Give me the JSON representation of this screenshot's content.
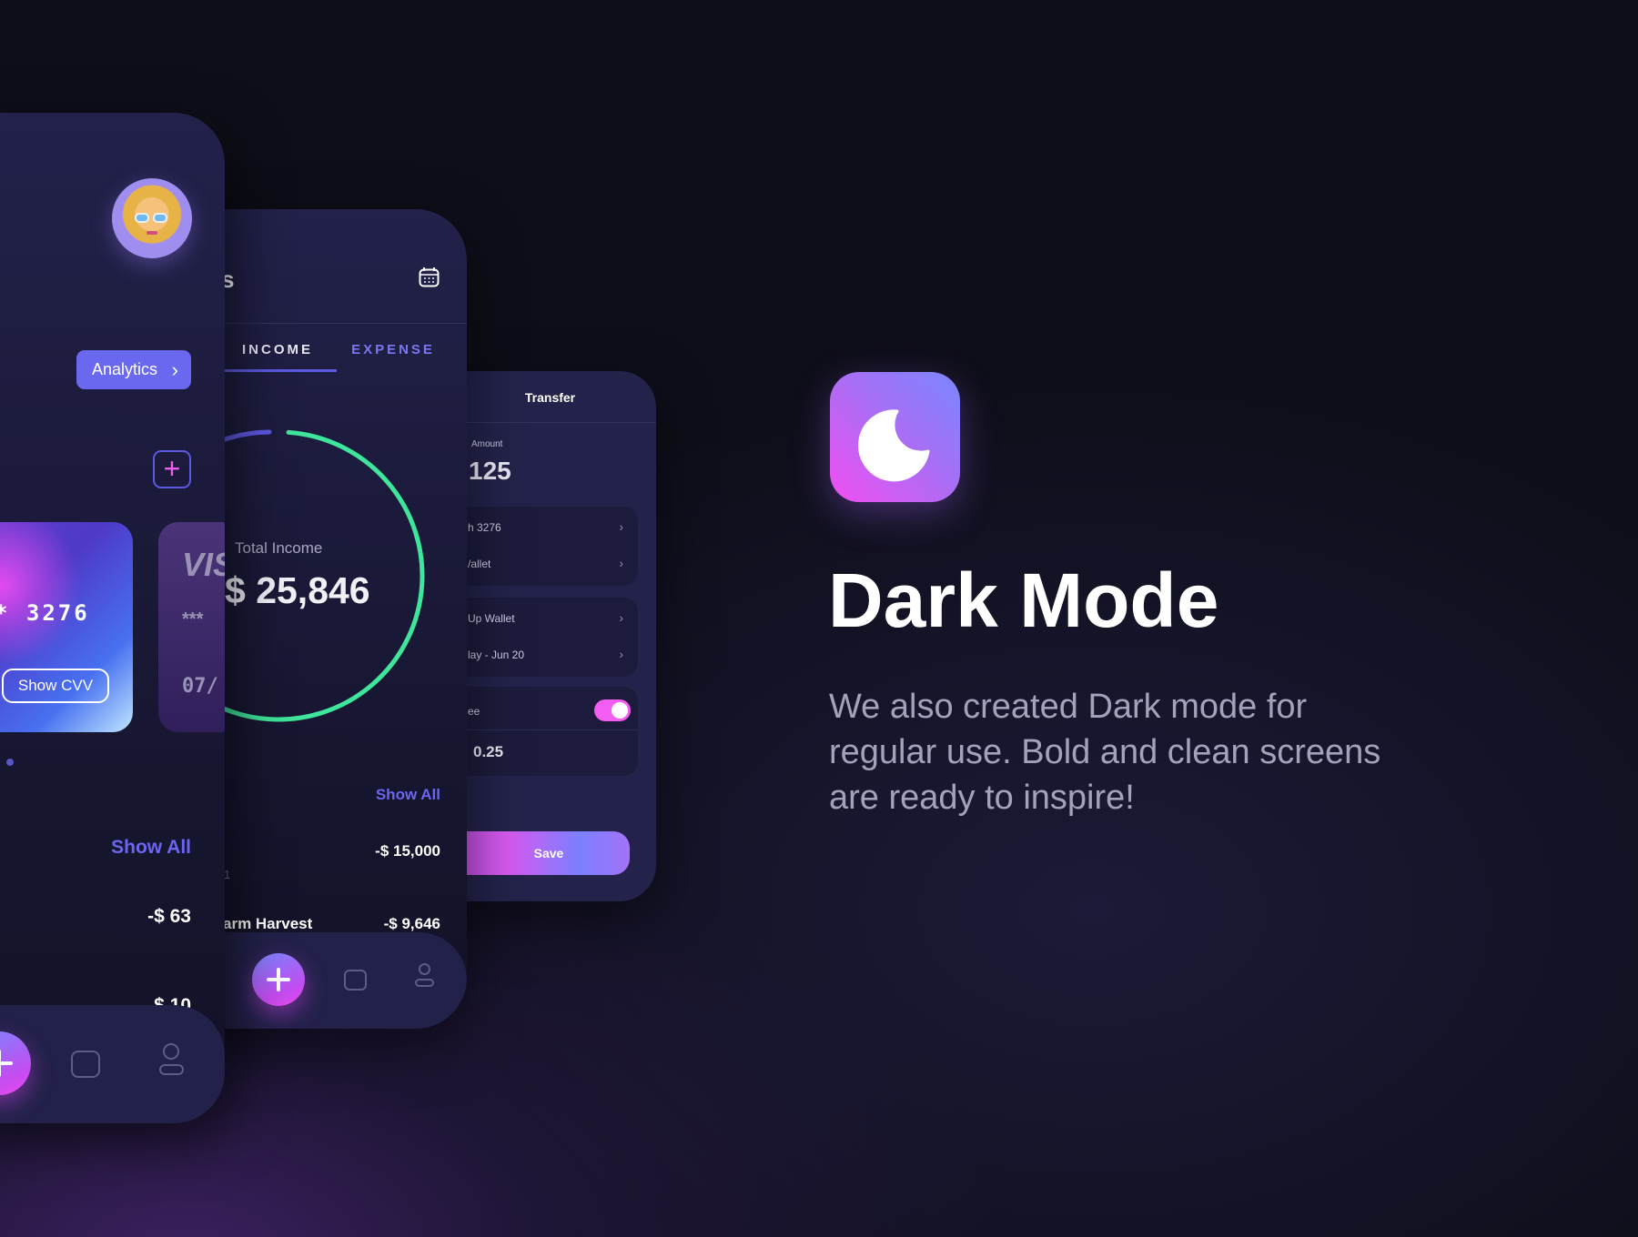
{
  "colors": {
    "accent": "#6b66f0",
    "income_ring": "#3ee59a",
    "toggle": "#f45df2",
    "background": "#0e0e19"
  },
  "panel_dashboard": {
    "analytics_label": "Analytics",
    "card1_number": "* 3276",
    "card1_cvv_label": "Show CVV",
    "card2_brand": "VIS",
    "card2_number": "***",
    "card2_expiry": "07/",
    "show_all": "Show All",
    "transactions": [
      {
        "amount": "-$ 63"
      },
      {
        "amount": "$ 10"
      }
    ],
    "nav_icons": [
      "plus-icon",
      "wallet-icon",
      "user-icon"
    ]
  },
  "panel_stats": {
    "title_partial": "s",
    "tabs": [
      {
        "label": "INCOME",
        "active": true
      },
      {
        "label": "EXPENSE",
        "active": false
      }
    ],
    "total_label": "Total Income",
    "total_value": "$ 25,846",
    "show_all": "Show All",
    "transactions": [
      {
        "name": "",
        "sub": "1",
        "amount": "-$ 15,000"
      },
      {
        "name": "arm Harvest",
        "amount": "-$ 9,646"
      }
    ]
  },
  "panel_transfer": {
    "title": "Transfer",
    "amount_label": "Amount",
    "amount_value": "125",
    "rows": [
      "h 3276",
      "/allet",
      "Up Wallet",
      "lay - Jun 20"
    ],
    "fee_label": "ee",
    "fee_enabled": true,
    "fee_value": "0.25",
    "save_label": "Save"
  },
  "promo": {
    "heading": "Dark Mode",
    "body": "We also created Dark mode for regular use. Bold and clean screens are ready to inspire!"
  }
}
